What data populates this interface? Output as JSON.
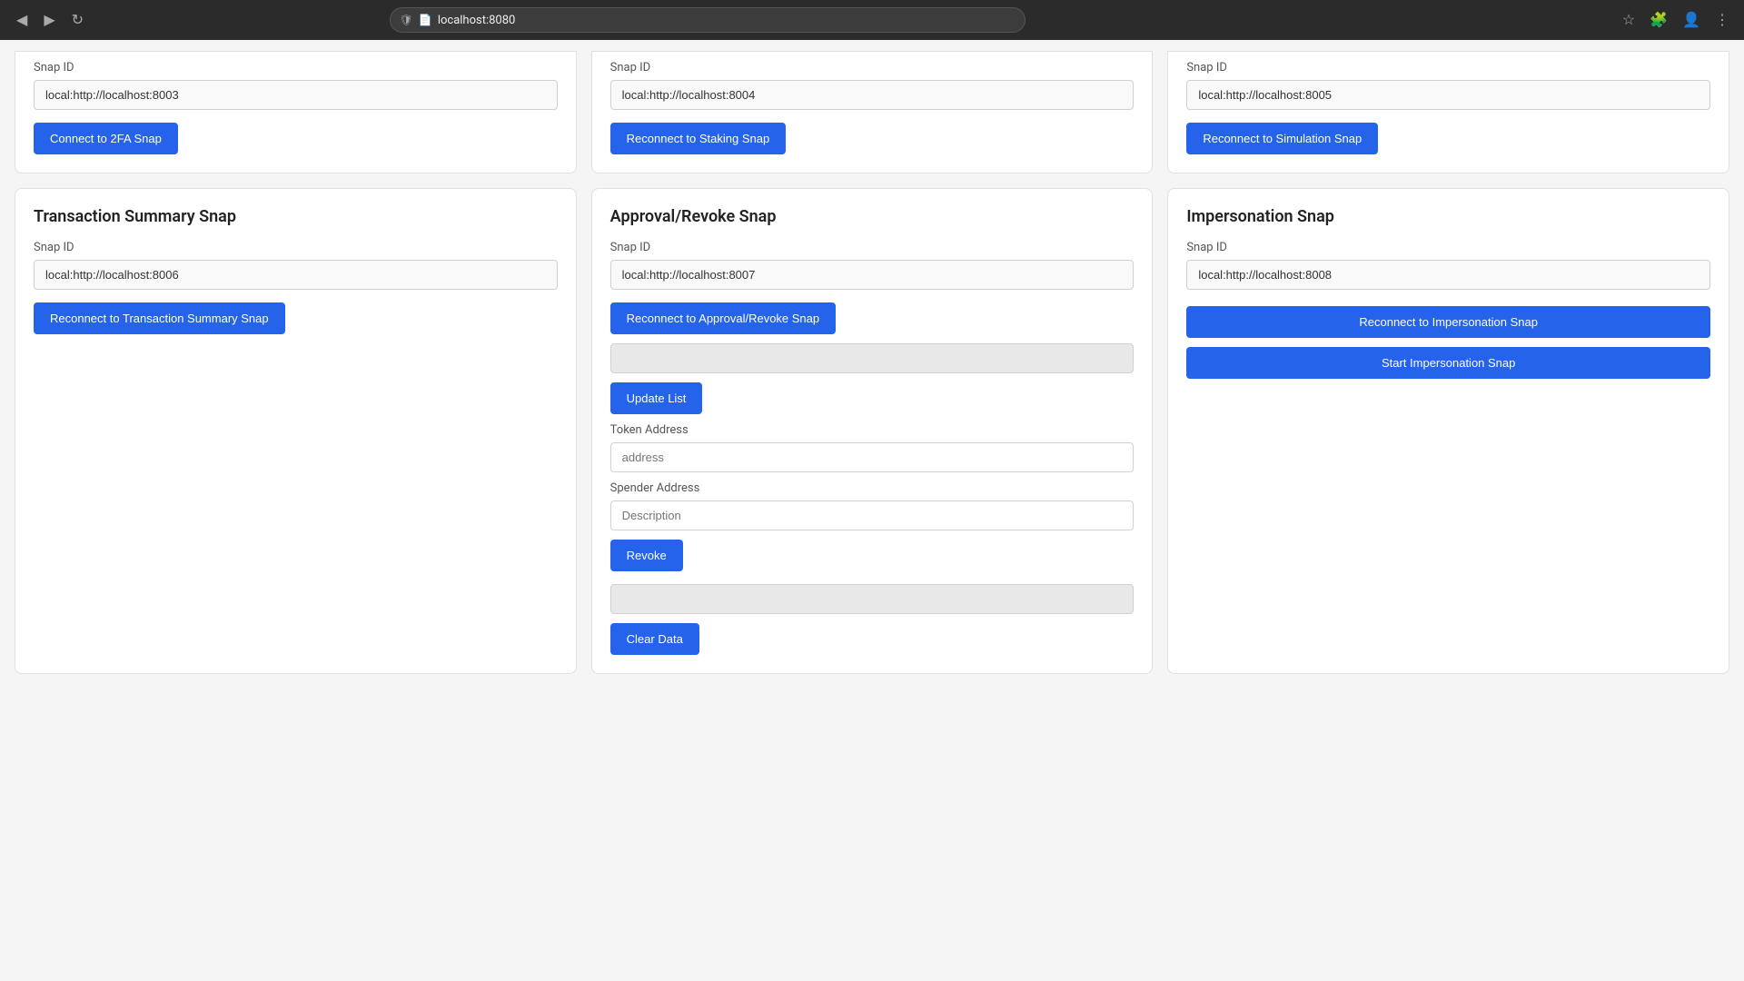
{
  "browser": {
    "url": "localhost:8080",
    "nav": {
      "back": "◀",
      "forward": "▶",
      "refresh": "↻"
    }
  },
  "partial_top_cards": [
    {
      "snap_id_value": "local:http://localhost:8003",
      "button_label": "Connect to 2FA Snap"
    },
    {
      "snap_id_value": "local:http://localhost:8004",
      "button_label": "Reconnect to Staking Snap"
    },
    {
      "snap_id_value": "local:http://localhost:8005",
      "button_label": "Reconnect to Simulation Snap"
    }
  ],
  "bottom_cards": [
    {
      "title": "Transaction Summary Snap",
      "snap_id_label": "Snap ID",
      "snap_id_value": "local:http://localhost:8006",
      "buttons": [
        "Reconnect to Transaction Summary Snap"
      ]
    },
    {
      "title": "Approval/Revoke Snap",
      "snap_id_label": "Snap ID",
      "snap_id_value": "local:http://localhost:8007",
      "buttons": [
        "Reconnect to Approval/Revoke Snap",
        "Update List",
        "Revoke",
        "Clear Data"
      ],
      "token_address_label": "Token Address",
      "token_address_placeholder": "address",
      "spender_address_label": "Spender Address",
      "spender_address_placeholder": "Description"
    },
    {
      "title": "Impersonation Snap",
      "snap_id_label": "Snap ID",
      "snap_id_value": "local:http://localhost:8008",
      "buttons": [
        "Reconnect to Impersonation Snap",
        "Start Impersonation Snap"
      ]
    }
  ]
}
